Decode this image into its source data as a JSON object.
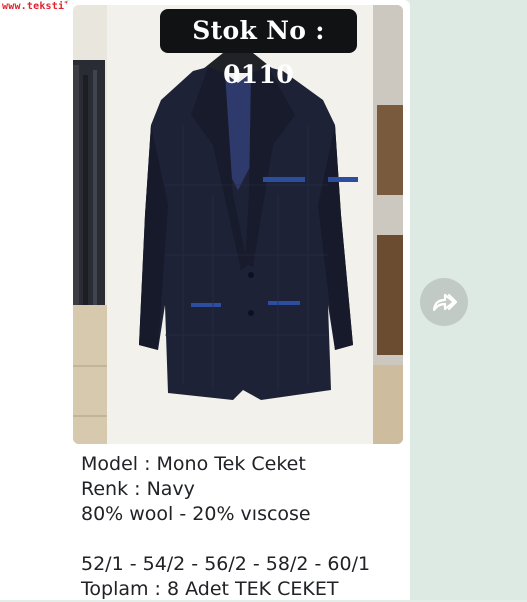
{
  "watermark": "www.tekstilportal.com",
  "post": {
    "stock_badge": "Stok No : 0110",
    "caption_lines": [
      "Model : Mono Tek Ceket",
      "Renk : Navy",
      "80% wool - 20% vıscose",
      "",
      "52/1 - 54/2 - 56/2 - 58/2 - 60/1",
      "Toplam : 8 Adet TEK CEKET"
    ]
  },
  "icons": {
    "forward": "forward-share-icon"
  },
  "colors": {
    "chat_background": "#e4eee9",
    "bubble": "#ffffff",
    "badge": "#111214",
    "watermark": "#e0222d",
    "jacket": "#1d2236"
  }
}
